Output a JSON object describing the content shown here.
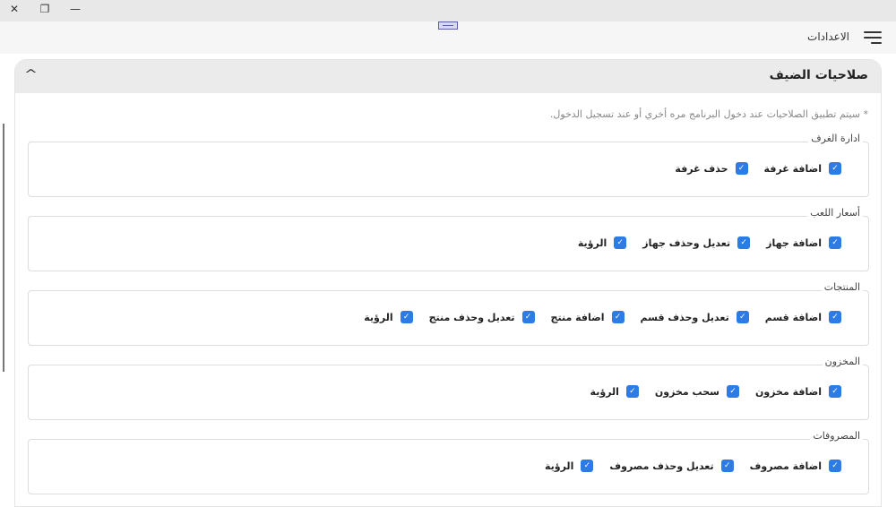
{
  "window": {
    "close": "✕",
    "restore": "❐",
    "minimize": "—"
  },
  "header": {
    "title": "الاعدادات"
  },
  "card": {
    "title": "صلاحيات الضيف",
    "note": "* سيتم تطبيق الصلاحيات عند دخول البرنامج مره أخري أو عند تسجيل الدخول."
  },
  "groups": [
    {
      "title": "ادارة الغرف",
      "items": [
        {
          "label": "اضافة غرفة",
          "checked": true
        },
        {
          "label": "حذف غرفة",
          "checked": true
        }
      ]
    },
    {
      "title": "أسعار اللعب",
      "items": [
        {
          "label": "اضافة جهاز",
          "checked": true
        },
        {
          "label": "تعديل وحذف جهاز",
          "checked": true
        },
        {
          "label": "الرؤية",
          "checked": true
        }
      ]
    },
    {
      "title": "المنتجات",
      "items": [
        {
          "label": "اضافة قسم",
          "checked": true
        },
        {
          "label": "تعديل وحذف قسم",
          "checked": true
        },
        {
          "label": "اضافة منتج",
          "checked": true
        },
        {
          "label": "تعديل وحذف منتج",
          "checked": true
        },
        {
          "label": "الرؤية",
          "checked": true
        }
      ]
    },
    {
      "title": "المخزون",
      "items": [
        {
          "label": "اضافة مخزون",
          "checked": true
        },
        {
          "label": "سحب مخزون",
          "checked": true
        },
        {
          "label": "الرؤية",
          "checked": true
        }
      ]
    },
    {
      "title": "المصروفات",
      "items": [
        {
          "label": "اضافة مصروف",
          "checked": true
        },
        {
          "label": "تعديل وحذف مصروف",
          "checked": true
        },
        {
          "label": "الرؤية",
          "checked": true
        }
      ]
    }
  ]
}
